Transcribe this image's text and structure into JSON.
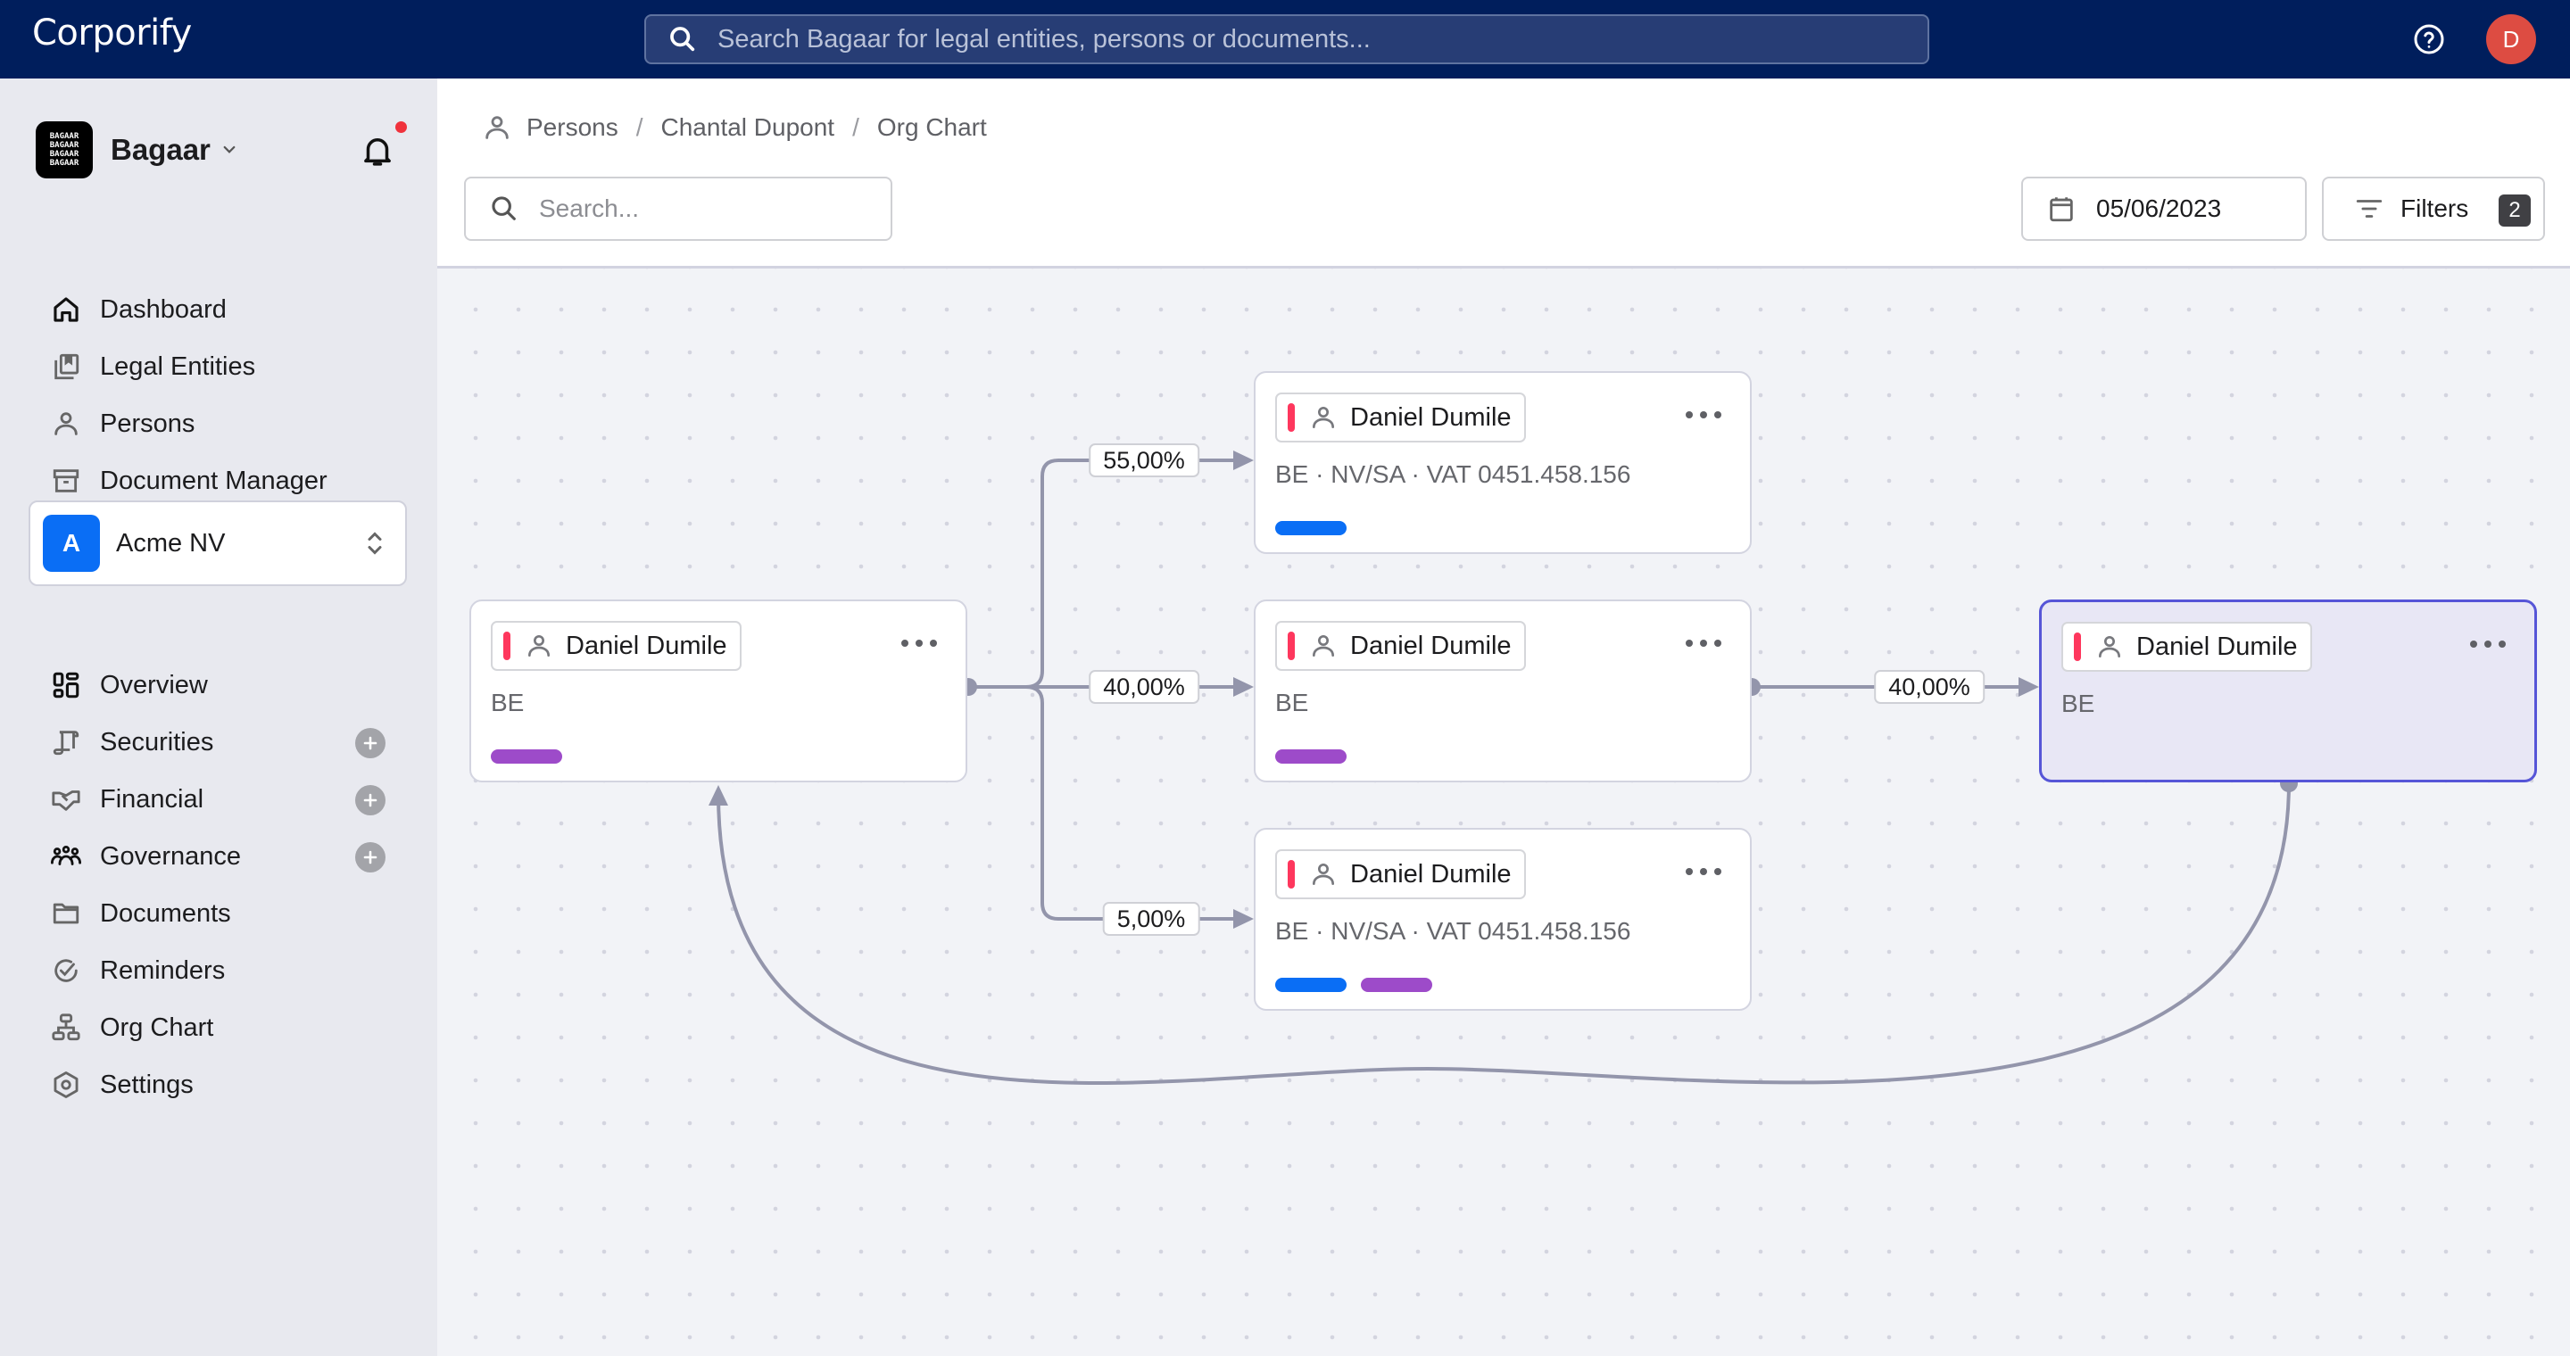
{
  "app": {
    "brand": "Corporify",
    "global_search_placeholder": "Search Bagaar for legal entities, persons or documents...",
    "user_initial": "D",
    "colors": {
      "header": "#001e5c",
      "avatar": "#dd4c42",
      "accent": "#0a6ef5",
      "selected_border": "#5655d7",
      "flag": "#fe375d",
      "tag_blue": "#0a6ef5",
      "tag_purple": "#9d4bc9"
    }
  },
  "sidebar": {
    "workspace_name": "Bagaar",
    "workspace_logo_lines": [
      "BAGAAR",
      "BAGAAR",
      "BAGAAR",
      "BAGAAR"
    ],
    "has_notification": true,
    "global_nav": [
      {
        "label": "Dashboard",
        "icon": "home-icon"
      },
      {
        "label": "Legal Entities",
        "icon": "legal-entities-icon"
      },
      {
        "label": "Persons",
        "icon": "person-icon"
      },
      {
        "label": "Document Manager",
        "icon": "archive-icon"
      }
    ],
    "entity": {
      "initial": "A",
      "name": "Acme NV"
    },
    "entity_nav": [
      {
        "label": "Overview",
        "icon": "overview-icon",
        "add": false
      },
      {
        "label": "Securities",
        "icon": "scroll-icon",
        "add": true
      },
      {
        "label": "Financial",
        "icon": "handshake-icon",
        "add": true
      },
      {
        "label": "Governance",
        "icon": "people-icon",
        "add": true
      },
      {
        "label": "Documents",
        "icon": "folder-icon",
        "add": false
      },
      {
        "label": "Reminders",
        "icon": "check-circle-icon",
        "add": false
      },
      {
        "label": "Org Chart",
        "icon": "org-chart-icon",
        "add": false
      },
      {
        "label": "Settings",
        "icon": "settings-icon",
        "add": false
      }
    ]
  },
  "toolbar": {
    "breadcrumb": [
      "Persons",
      "Chantal Dupont",
      "Org Chart"
    ],
    "search_placeholder": "Search...",
    "date": "05/06/2023",
    "filters_label": "Filters",
    "filters_count": "2"
  },
  "org_chart": {
    "nodes": [
      {
        "id": "n1",
        "name": "Daniel Dumile",
        "info": "BE",
        "tags": [
          "purple"
        ],
        "selected": false
      },
      {
        "id": "n2",
        "name": "Daniel Dumile",
        "info": "BE · NV/SA · VAT 0451.458.156",
        "tags": [
          "blue"
        ],
        "selected": false
      },
      {
        "id": "n3",
        "name": "Daniel Dumile",
        "info": "BE",
        "tags": [
          "purple"
        ],
        "selected": false
      },
      {
        "id": "n4",
        "name": "Daniel Dumile",
        "info": "BE · NV/SA · VAT 0451.458.156",
        "tags": [
          "blue",
          "purple"
        ],
        "selected": false
      },
      {
        "id": "n5",
        "name": "Daniel Dumile",
        "info": "BE",
        "tags": [],
        "selected": true
      }
    ],
    "edges": [
      {
        "from": "n1",
        "to": "n2",
        "label": "55,00%"
      },
      {
        "from": "n1",
        "to": "n3",
        "label": "40,00%"
      },
      {
        "from": "n1",
        "to": "n4",
        "label": "5,00%"
      },
      {
        "from": "n3",
        "to": "n5",
        "label": "40,00%"
      },
      {
        "from": "n5",
        "to": "n1",
        "label": ""
      }
    ]
  }
}
